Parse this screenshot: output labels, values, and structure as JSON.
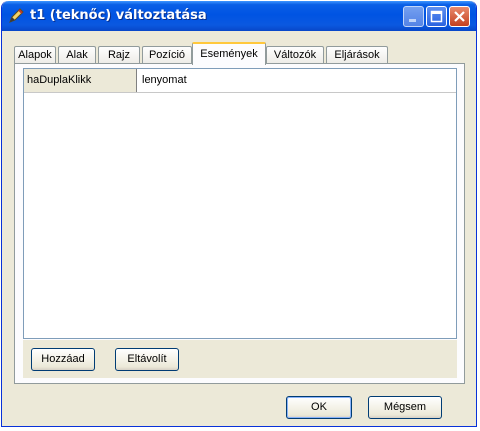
{
  "window": {
    "title": "t1 (teknőc) változtatása",
    "icon": "pen-icon",
    "controls": [
      "minimize-icon",
      "maximize-icon",
      "close-icon"
    ]
  },
  "tabs": [
    {
      "label": "Alapok",
      "active": false
    },
    {
      "label": "Alak",
      "active": false
    },
    {
      "label": "Rajz",
      "active": false
    },
    {
      "label": "Pozíció",
      "active": false
    },
    {
      "label": "Események",
      "active": true
    },
    {
      "label": "Változók",
      "active": false
    },
    {
      "label": "Eljárások",
      "active": false
    }
  ],
  "events": {
    "rows": [
      {
        "event": "haDuplaKlikk",
        "action": "lenyomat"
      }
    ]
  },
  "panel_buttons": {
    "add_label": "Hozzáad",
    "remove_label": "Eltávolít"
  },
  "dialog_buttons": {
    "ok_label": "OK",
    "cancel_label": "Mégsem"
  },
  "colors": {
    "titlebar": "#0054e3",
    "active_tab_highlight": "#ffc83c",
    "close_button": "#c4401f"
  }
}
